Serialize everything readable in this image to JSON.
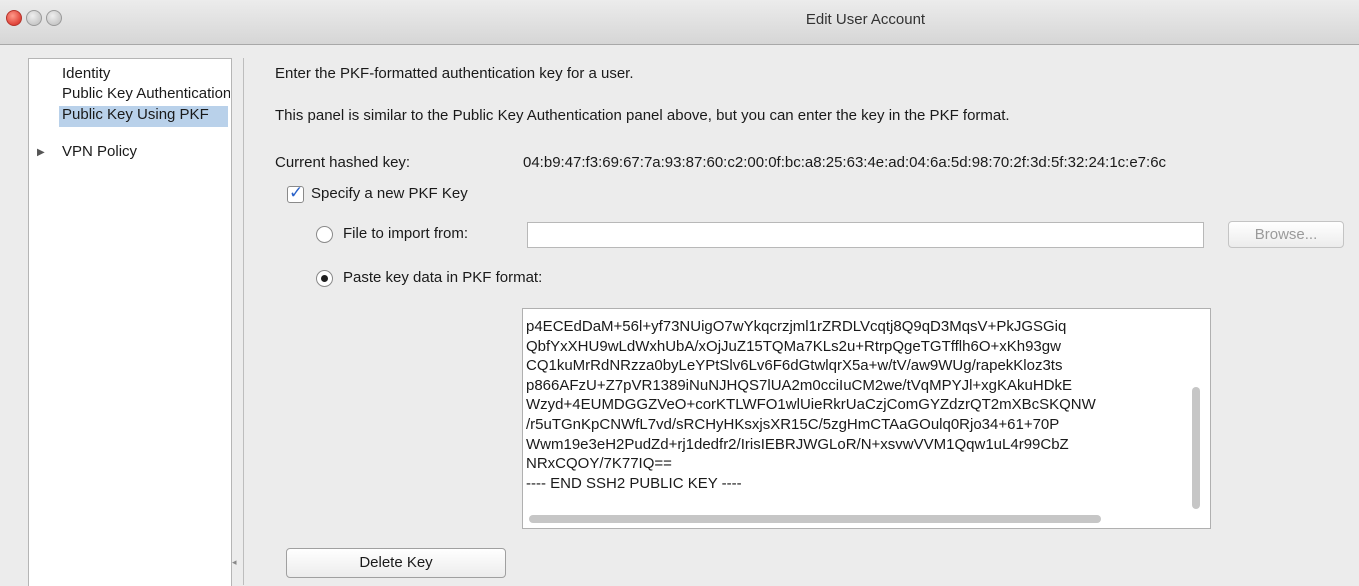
{
  "window": {
    "title": "Edit User Account"
  },
  "sidebar": {
    "items": [
      {
        "label": "Identity",
        "selected": false
      },
      {
        "label": "Public Key Authentication",
        "selected": false
      },
      {
        "label": "Public Key Using PKF",
        "selected": true
      },
      {
        "label": "VPN Policy",
        "selected": false,
        "expandable": true
      }
    ],
    "selection_color": "#b9d1ea"
  },
  "panel": {
    "heading": "Enter the PKF-formatted authentication key for a user.",
    "description": "This panel is similar to the Public Key Authentication panel above, but you can enter the key in the PKF format.",
    "current_key_label": "Current hashed key:",
    "current_key_value": "04:b9:47:f3:69:67:7a:93:87:60:c2:00:0f:bc:a8:25:63:4e:ad:04:6a:5d:98:70:2f:3d:5f:32:24:1c:e7:6c",
    "specify_checkbox": {
      "label": "Specify a new PKF Key",
      "checked": true
    },
    "file_radio": {
      "label": "File to import from:",
      "selected": false
    },
    "file_field": {
      "value": ""
    },
    "browse_button": {
      "label": "Browse...",
      "enabled": false
    },
    "paste_radio": {
      "label": "Paste key data in PKF format:",
      "selected": true
    },
    "key_data_lines": [
      "p4ECEdDaM+56l+yf73NUigO7wYkqcrzjml1rZRDLVcqtj8Q9qD3MqsV+PkJGSGiq",
      "QbfYxXHU9wLdWxhUbA/xOjJuZ15TQMa7KLs2u+RtrpQgeTGTfflh6O+xKh93gw",
      "CQ1kuMrRdNRzza0byLeYPtSlv6Lv6F6dGtwlqrX5a+w/tV/aw9WUg/rapekKloz3ts",
      "p866AFzU+Z7pVR1389iNuNJHQS7lUA2m0cciIuCM2we/tVqMPYJl+xgKAkuHDkE",
      "Wzyd+4EUMDGGZVeO+corKTLWFO1wlUieRkrUaCzjComGYZdzrQT2mXBcSKQNW",
      "/r5uTGnKpCNWfL7vd/sRCHyHKsxjsXR15C/5zgHmCTAaGOulq0Rjo34+61+70P",
      "Wwm19e3eH2PudZd+rj1dedfr2/IrisIEBRJWGLoR/N+xsvwVVM1Qqw1uL4r99CbZ",
      "NRxCQOY/7K77IQ==",
      "---- END SSH2 PUBLIC KEY ----"
    ],
    "delete_button": {
      "label": "Delete Key"
    }
  },
  "icons": {
    "close": "red-close-circle",
    "minimize": "gray-minimize-circle",
    "zoom": "gray-zoom-circle",
    "disclosure": "triangle-right",
    "checkmark": "check"
  }
}
